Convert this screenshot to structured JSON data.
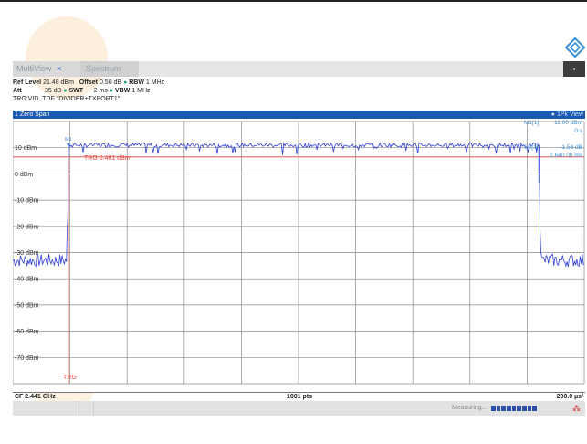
{
  "window": {
    "tabs": [
      {
        "label": "MultiView",
        "close": "×"
      },
      {
        "label": "Spectrum"
      }
    ],
    "menu_icon": "▪"
  },
  "params": {
    "line1": {
      "ref_level_label": "Ref Level",
      "ref_level": "21.48 dBm",
      "offset_label": "Offset",
      "offset": "0.50 dB",
      "rbw_label": "RBW",
      "rbw": "1 MHz"
    },
    "line2": {
      "att_label": "Att",
      "att": "35 dB",
      "swt_label": "SWT",
      "swt": "2 ms",
      "vbw_label": "VBW",
      "vbw": "1 MHz"
    },
    "line3": "TRG:VID  TDF \"DIVIDER+TXPORT1\""
  },
  "diagram": {
    "title": "1 Zero Span",
    "trace_label": "● 1Pk View",
    "y_ticks": [
      "10 dBm",
      "0 dBm",
      "-10 dBm",
      "-20 dBm",
      "-30 dBm",
      "-40 dBm",
      "-50 dBm",
      "-60 dBm",
      "-70 dBm"
    ],
    "trigger_line_label": "TRG 6.481 dBm",
    "trigger_marker_label": "TRG",
    "marker_label": "M1",
    "marker_readout": {
      "m1_name": "M1[1]",
      "m1_value": "11.00 dBm",
      "m1_time": "0 s",
      "d2_name": "D2[1]",
      "d2_value": "-1.56 dB",
      "d2_time": "1.640 00 ms"
    }
  },
  "footer": {
    "center_freq": "CF 2.441 GHz",
    "points": "1001 pts",
    "span_per_div": "200.0 µs/"
  },
  "status": {
    "measuring": "Measuring...",
    "progress_segments": 9,
    "network_icon": "network-icon"
  },
  "colors": {
    "accent": "#1b58b0",
    "trace": "#2f3fd6",
    "trigger": "#e0453d",
    "marker": "#3a8dd8"
  }
}
